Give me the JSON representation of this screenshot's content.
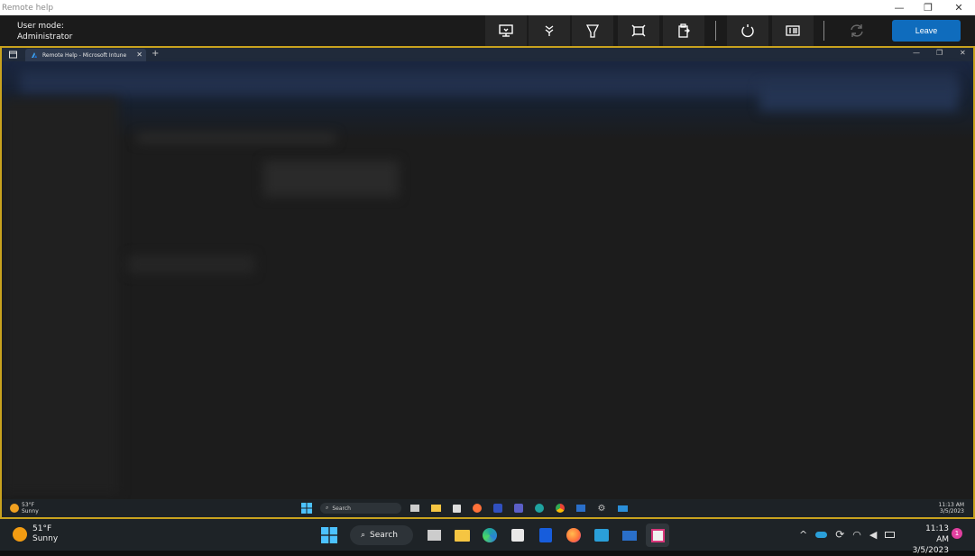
{
  "window": {
    "title": "Remote help"
  },
  "toolbar": {
    "user_mode_label": "User mode:",
    "user_mode_value": "Administrator",
    "leave_label": "Leave",
    "icons": [
      "monitor-icon",
      "laser-pointer-icon",
      "highlighter-icon",
      "fullscreen-icon",
      "clipboard-icon",
      "restart-icon",
      "task-manager-icon",
      "refresh-icon"
    ]
  },
  "remote": {
    "browser_tab_title": "Remote Help - Microsoft Intune",
    "taskbar": {
      "weather_temp": "53°F",
      "weather_desc": "Sunny",
      "search_label": "Search",
      "time": "11:13 AM",
      "date": "3/5/2023"
    }
  },
  "taskbar": {
    "weather_temp": "51°F",
    "weather_desc": "Sunny",
    "search_label": "Search",
    "time": "11:13 AM",
    "date": "3/5/2023",
    "notification_count": "1"
  },
  "colors": {
    "accent": "#0f6cbd",
    "session_border": "#c8a21e",
    "toolbar_bg": "#1b1b1b"
  }
}
